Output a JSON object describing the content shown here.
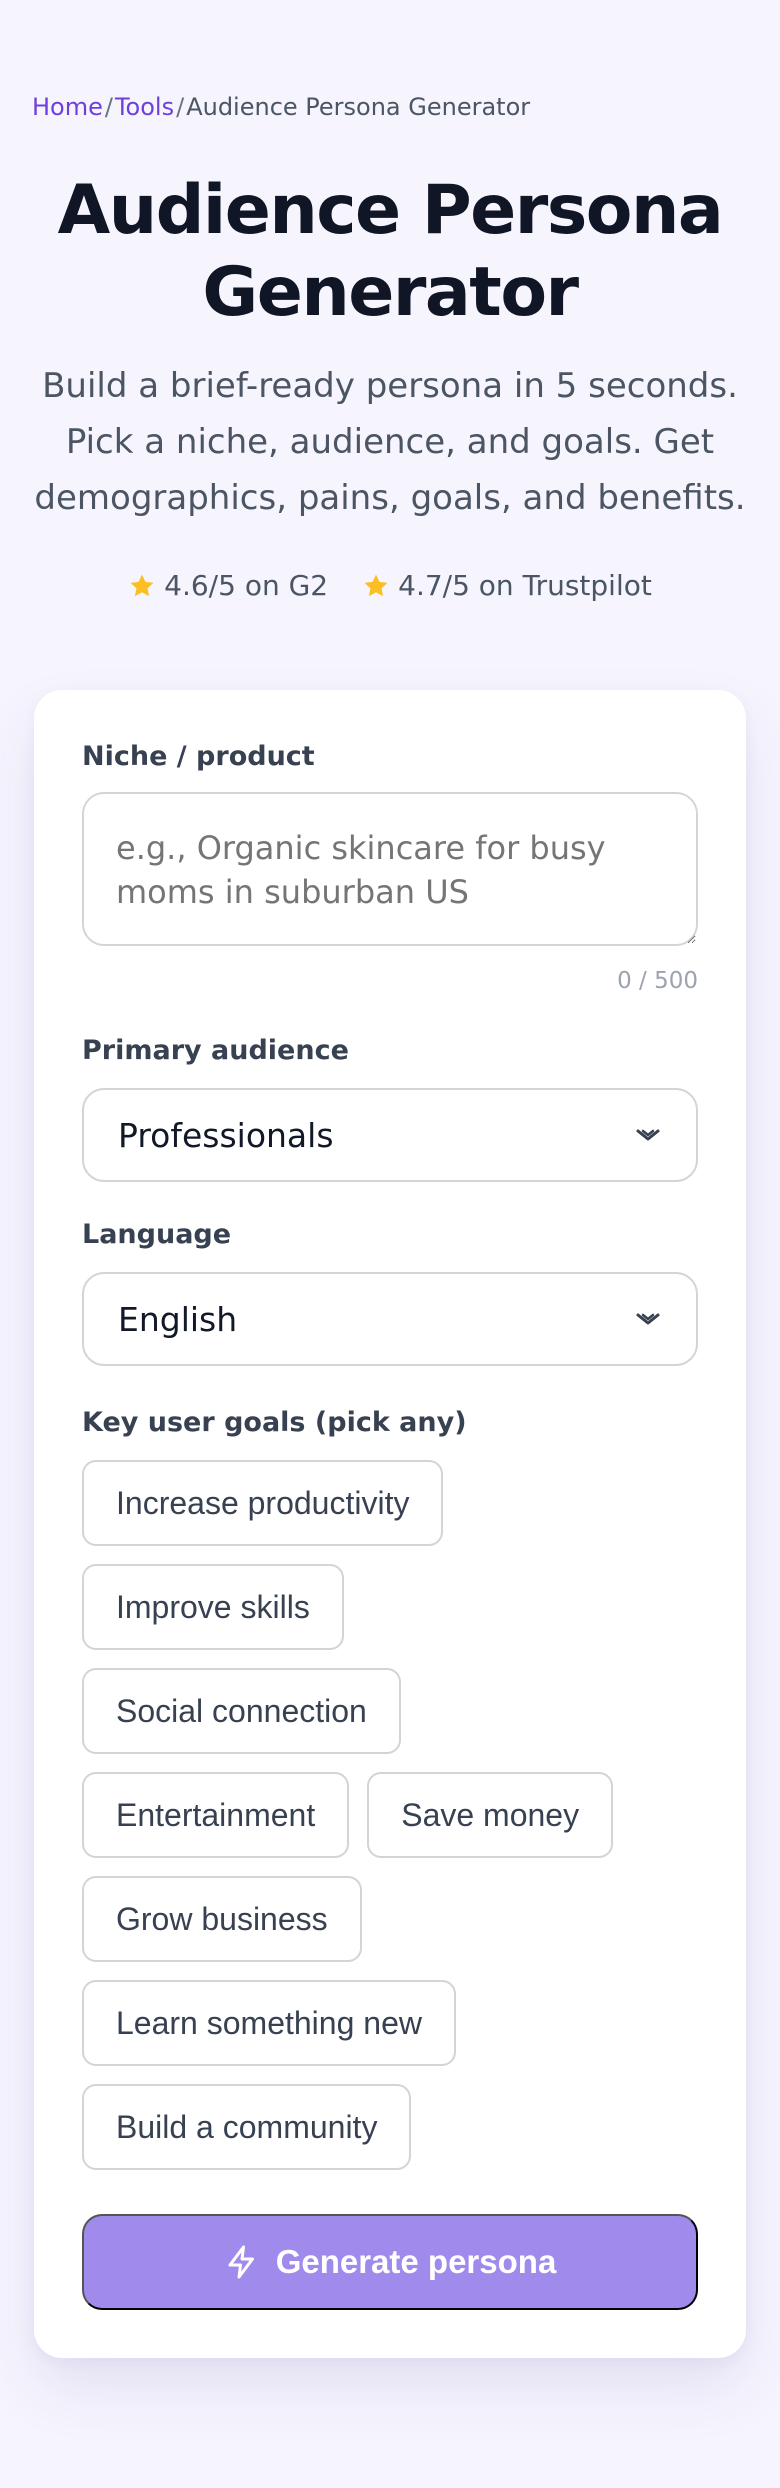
{
  "breadcrumb": {
    "home": "Home",
    "tools": "Tools",
    "current": "Audience Persona Generator",
    "separator": "/"
  },
  "hero": {
    "title_line1": "Audience Persona",
    "title_line2": "Generator",
    "subtitle_line1": "Build a brief-ready persona in 5 seconds.",
    "subtitle_line2": "Pick a niche, audience, and goals. Get",
    "subtitle_line3": "demographics, pains, goals, and benefits."
  },
  "ratings": [
    {
      "text": "4.6/5 on G2",
      "icon": "star-icon"
    },
    {
      "text": "4.7/5 on Trustpilot",
      "icon": "star-icon"
    }
  ],
  "form": {
    "niche": {
      "label": "Niche / product",
      "placeholder": "e.g., Organic skincare for busy moms in suburban US",
      "value": "",
      "counter": "0 / 500"
    },
    "audience": {
      "label": "Primary audience",
      "value": "Professionals"
    },
    "language": {
      "label": "Language",
      "value": "English"
    },
    "goals": {
      "label": "Key user goals (pick any)",
      "options": [
        "Increase productivity",
        "Improve skills",
        "Social connection",
        "Entertainment",
        "Save money",
        "Grow business",
        "Learn something new",
        "Build a community"
      ]
    },
    "submit_label": "Generate persona"
  },
  "colors": {
    "accent": "#6d3fe0",
    "cta": "#a08bed",
    "star": "#fbbf24",
    "background": "#f6f5fe"
  }
}
